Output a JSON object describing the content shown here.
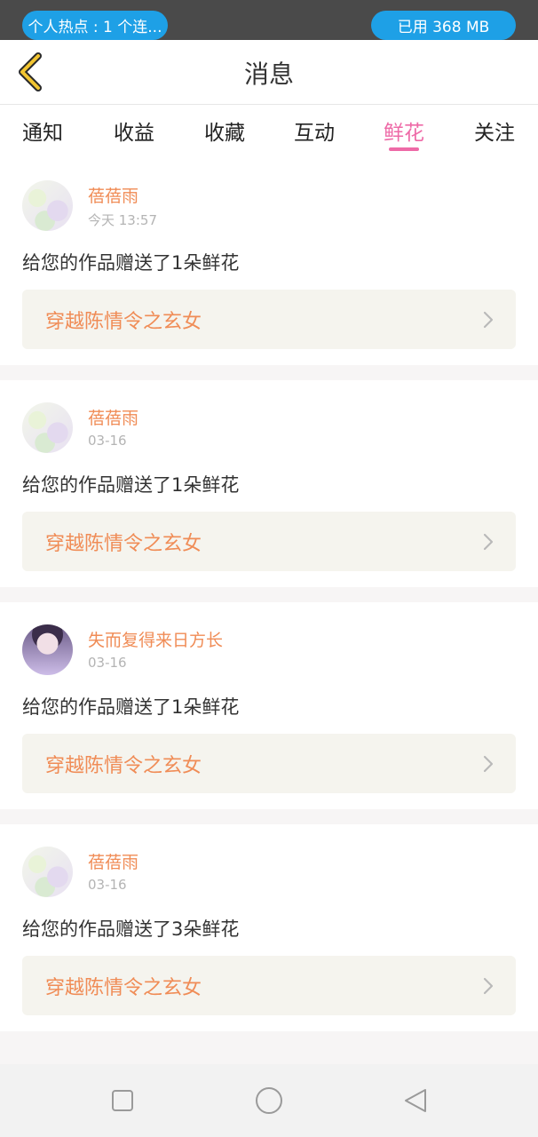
{
  "status_bar": {
    "hotspot": "个人热点 : 1 个连...",
    "memory": "已用 368 MB"
  },
  "header": {
    "title": "消息",
    "back_icon": "chevron-left-icon"
  },
  "tabs": [
    {
      "label": "通知"
    },
    {
      "label": "收益"
    },
    {
      "label": "收藏"
    },
    {
      "label": "互动"
    },
    {
      "label": "鲜花",
      "active": true
    },
    {
      "label": "关注"
    }
  ],
  "notifications": [
    {
      "user": "蓓蓓雨",
      "time": "今天 13:57",
      "message": "给您的作品赠送了1朵鲜花",
      "work": "穿越陈情令之玄女"
    },
    {
      "user": "蓓蓓雨",
      "time": "03-16",
      "message": "给您的作品赠送了1朵鲜花",
      "work": "穿越陈情令之玄女"
    },
    {
      "user": "失而复得来日方长",
      "time": "03-16",
      "message": "给您的作品赠送了1朵鲜花",
      "work": "穿越陈情令之玄女"
    },
    {
      "user": "蓓蓓雨",
      "time": "03-16",
      "message": "给您的作品赠送了3朵鲜花",
      "work": "穿越陈情令之玄女"
    }
  ],
  "colors": {
    "accent_pink": "#ee6aa7",
    "name_orange": "#f08c56",
    "status_blue": "#1ea0e6",
    "back_yellow": "#f2c531"
  },
  "nav_icons": [
    "square-icon",
    "circle-icon",
    "triangle-back-icon"
  ]
}
